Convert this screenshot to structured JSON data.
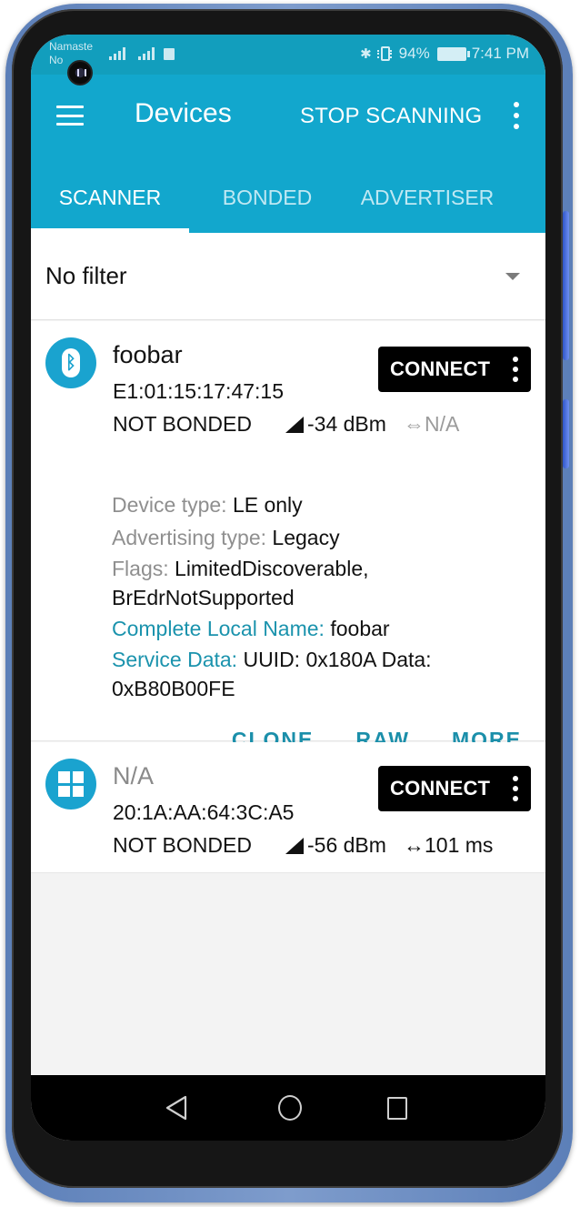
{
  "status_bar": {
    "carrier_line1": "Namaste",
    "carrier_line2": "No",
    "battery_percent": "94%",
    "time": "7:41 PM",
    "bluetooth_glyph": "✱"
  },
  "app_bar": {
    "title": "Devices",
    "action_label": "STOP SCANNING",
    "menu_icon": "hamburger-icon",
    "overflow_icon": "more-vert-icon"
  },
  "tabs": [
    {
      "label": "SCANNER",
      "active": true
    },
    {
      "label": "BONDED",
      "active": false
    },
    {
      "label": "ADVERTISER",
      "active": false
    }
  ],
  "filter": {
    "value": "No filter"
  },
  "devices": [
    {
      "icon": "bluetooth-icon",
      "name": "foobar",
      "address": "E1:01:15:17:47:15",
      "bond_state": "NOT BONDED",
      "rssi": "-34 dBm",
      "interval_arrow": "⇔",
      "interval": "N/A",
      "connect_label": "CONNECT",
      "details": {
        "device_type_key": "Device type: ",
        "device_type_val": "LE only",
        "adv_type_key": "Advertising type: ",
        "adv_type_val": "Legacy",
        "flags_key": "Flags: ",
        "flags_val": "LimitedDiscoverable,",
        "flags_val2": "BrEdrNotSupported",
        "local_name_key": "Complete Local Name: ",
        "local_name_val": "foobar",
        "service_data_key": "Service Data: ",
        "service_data_val": "UUID: 0x180A Data:",
        "service_data_val2": "0xB80B00FE"
      },
      "actions": [
        "CLONE",
        "RAW",
        "MORE"
      ]
    },
    {
      "icon": "windows-icon",
      "name": "N/A",
      "address": "20:1A:AA:64:3C:A5",
      "bond_state": "NOT BONDED",
      "rssi": "-56 dBm",
      "interval_arrow": "↔",
      "interval": "101 ms",
      "connect_label": "CONNECT"
    }
  ],
  "colors": {
    "status_bar": "#129ebd",
    "primary": "#12a7cd",
    "accent_teal": "#1b93ad",
    "connect_button": "#000000"
  }
}
